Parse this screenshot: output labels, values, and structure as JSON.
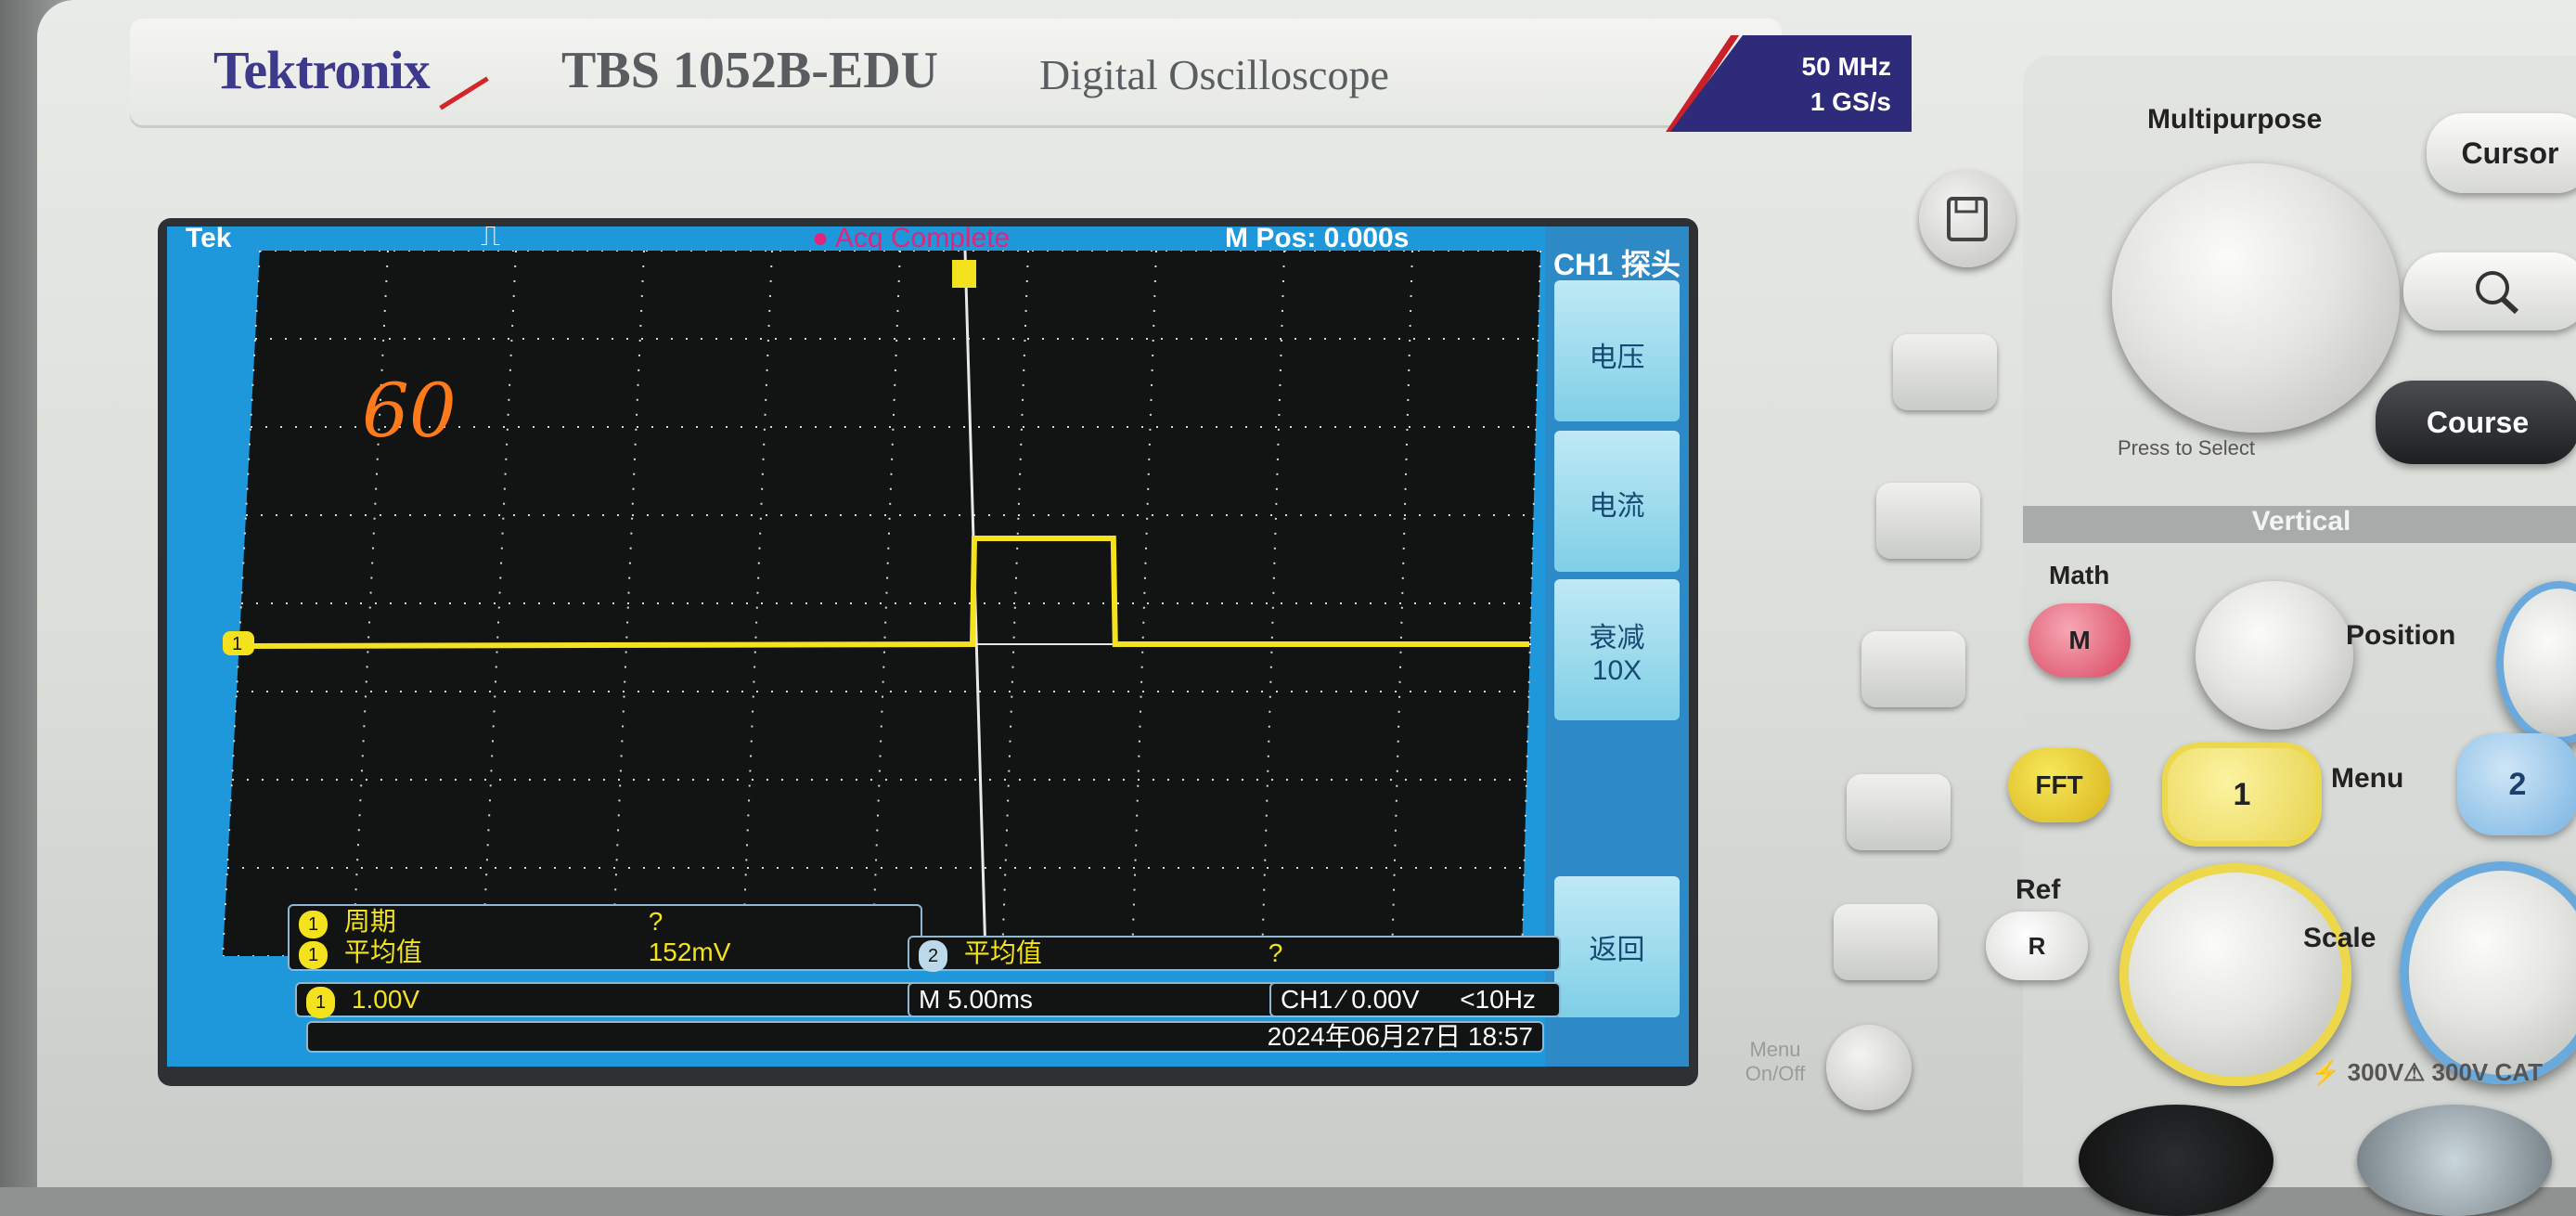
{
  "brand": {
    "logo": "Tektronix",
    "model": "TBS 1052B-EDU",
    "subtitle": "Digital Oscilloscope",
    "bandwidth": "50 MHz",
    "sample_rate": "1 GS/s"
  },
  "screen": {
    "tek_label": "Tek",
    "acq_status": "Acq Complete",
    "mpos": "M Pos: 0.000s",
    "handwritten_note": "60",
    "ch1_marker": "1",
    "trace_color": "#f3e21d",
    "pulse": {
      "start_time_ms": 0.0,
      "duration_ms": 5.5,
      "high_div": 1.2
    }
  },
  "menu": {
    "title": "CH1 探头",
    "items": [
      {
        "label": "电压"
      },
      {
        "label": "电流"
      },
      {
        "label": "衰减",
        "value": "10X"
      },
      {
        "label": ""
      },
      {
        "label": "返回"
      }
    ]
  },
  "measurements": {
    "ch1_period_label": "周期",
    "ch1_period_value": "?",
    "ch1_mean_label": "平均值",
    "ch1_mean_value": "152mV",
    "ch2_mean_label": "平均值",
    "ch2_mean_value": "?",
    "ch1_badge": "1",
    "ch2_badge": "2"
  },
  "status": {
    "ch1_scale": "1.00V",
    "timebase": "M 5.00ms",
    "trigger": "CH1 ∕ 0.00V",
    "freq": "<10Hz",
    "datetime": "2024年06月27日 18:57"
  },
  "panel": {
    "save_icon": "save-icon",
    "multipurpose": "Multipurpose",
    "press_to_select": "Press to Select",
    "cursor": "Cursor",
    "zoom_icon": "magnifier-icon",
    "course": "Course",
    "vertical": "Vertical",
    "math": "Math",
    "math_btn": "M",
    "position": "Position",
    "fft": "FFT",
    "ch1_btn": "1",
    "menu": "Menu",
    "ch2_btn": "2",
    "ref": "Ref",
    "ref_btn": "R",
    "scale": "Scale",
    "menu_onoff": "Menu On/Off",
    "cat_rating_1": "300V",
    "cat_rating_2": "300V CAT"
  }
}
